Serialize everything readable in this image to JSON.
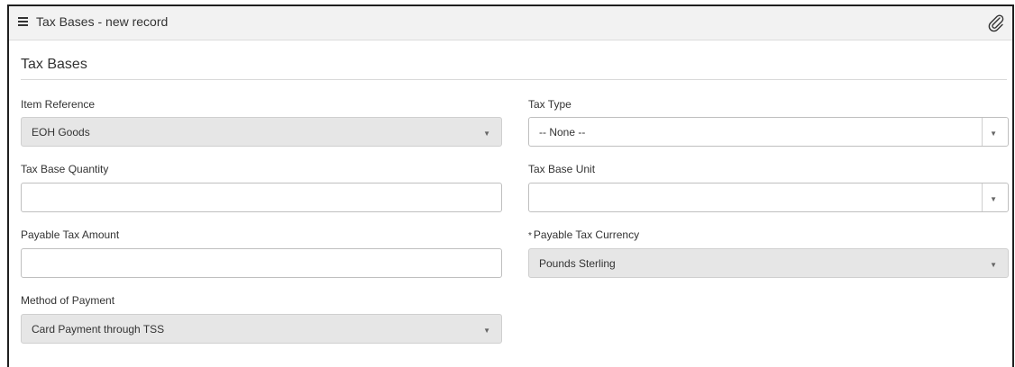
{
  "header": {
    "title": "Tax Bases - new record",
    "menu_icon": "hamburger-menu-icon",
    "attachment_icon": "paperclip-icon"
  },
  "section": {
    "title": "Tax Bases"
  },
  "fields": {
    "item_reference": {
      "label": "Item Reference",
      "value": "EOH Goods",
      "read_only": true
    },
    "tax_type": {
      "label": "Tax Type",
      "value": "-- None --"
    },
    "tax_base_quantity": {
      "label": "Tax Base Quantity",
      "value": ""
    },
    "tax_base_unit": {
      "label": "Tax Base Unit",
      "value": ""
    },
    "payable_tax_amount": {
      "label": "Payable Tax Amount",
      "value": ""
    },
    "payable_tax_currency": {
      "label": "Payable Tax Currency",
      "required_mark": "*",
      "value": "Pounds Sterling",
      "read_only": true
    },
    "method_of_payment": {
      "label": "Method of Payment",
      "value": "Card Payment through TSS",
      "read_only": true
    }
  },
  "dropdown_arrow": "▼"
}
